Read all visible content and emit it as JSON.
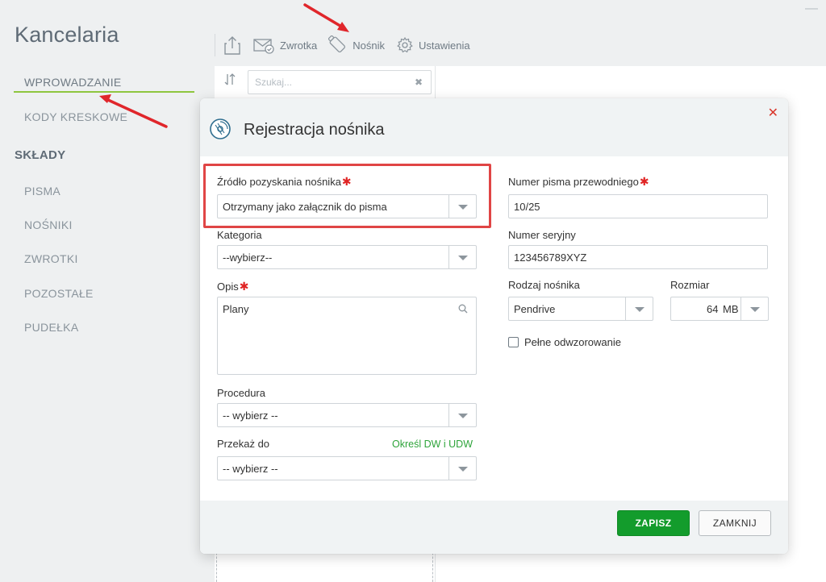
{
  "app": {
    "title": "Kancelaria"
  },
  "sidebar": {
    "items": [
      {
        "label": "WPROWADZANIE"
      },
      {
        "label": "KODY KRESKOWE"
      }
    ],
    "section": "SKŁADY",
    "section_items": [
      {
        "label": "PISMA"
      },
      {
        "label": "NOŚNIKI"
      },
      {
        "label": "ZWROTKI"
      },
      {
        "label": "POZOSTAŁE"
      },
      {
        "label": "PUDEŁKA"
      }
    ]
  },
  "toolbar": {
    "export_icon": "export-icon",
    "zwrotka_label": "Zwrotka",
    "nosnik_label": "Nośnik",
    "ustawienia_label": "Ustawienia"
  },
  "list": {
    "search_placeholder": "Szukaj..."
  },
  "modal": {
    "title": "Rejestracja nośnika",
    "icon": "disc-icon",
    "fields": {
      "zrodlo": {
        "label": "Źródło pozyskania nośnika",
        "value": "Otrzymany jako załącznik do pisma"
      },
      "kategoria": {
        "label": "Kategoria",
        "value": "--wybierz--"
      },
      "opis": {
        "label": "Opis",
        "value": "Plany"
      },
      "procedura": {
        "label": "Procedura",
        "value": "-- wybierz --"
      },
      "przekaz": {
        "label": "Przekaż do",
        "value": "-- wybierz --",
        "link": "Określ DW i UDW"
      },
      "numer_pisma": {
        "label": "Numer pisma przewodniego",
        "value": "10/25"
      },
      "numer_seryjny": {
        "label": "Numer seryjny",
        "value": "123456789XYZ"
      },
      "rodzaj": {
        "label": "Rodzaj nośnika",
        "value": "Pendrive"
      },
      "rozmiar": {
        "label": "Rozmiar",
        "value": "64",
        "unit": "MB"
      },
      "pelne": {
        "label": "Pełne odwzorowanie",
        "checked": false
      }
    },
    "required_marker": "✱",
    "buttons": {
      "save": "ZAPISZ",
      "close": "ZAMKNIJ"
    }
  },
  "colors": {
    "accent_green": "#139c2c",
    "link_green": "#2ea43a",
    "required_red": "#e02424",
    "annotation_red": "#e04545"
  }
}
